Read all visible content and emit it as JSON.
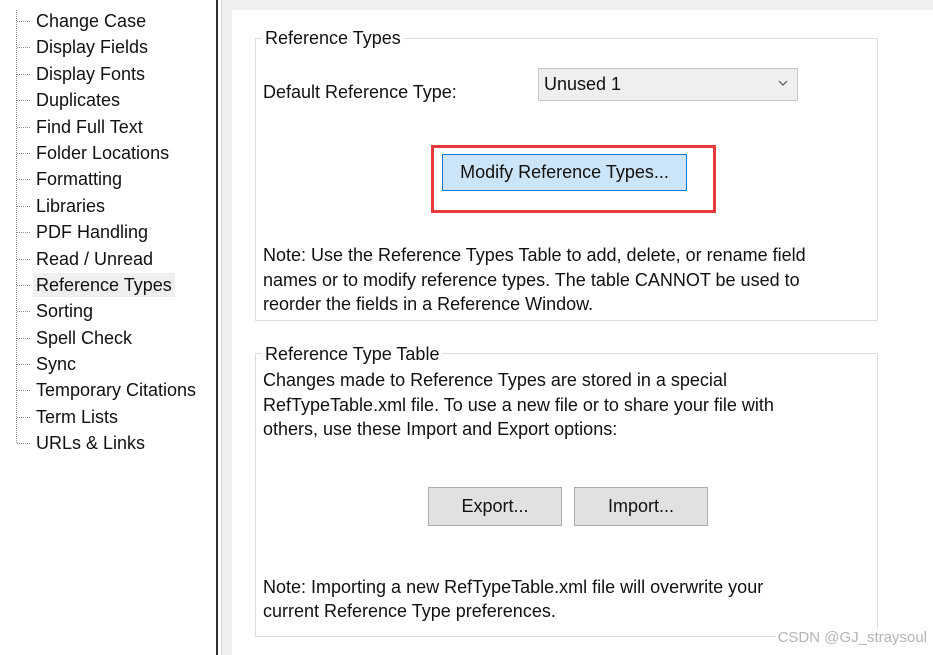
{
  "tree": {
    "items": [
      {
        "label": "Change Case"
      },
      {
        "label": "Display Fields"
      },
      {
        "label": "Display Fonts"
      },
      {
        "label": "Duplicates"
      },
      {
        "label": "Find Full Text"
      },
      {
        "label": "Folder Locations"
      },
      {
        "label": "Formatting"
      },
      {
        "label": "Libraries"
      },
      {
        "label": "PDF Handling"
      },
      {
        "label": "Read / Unread"
      },
      {
        "label": "Reference Types",
        "selected": true
      },
      {
        "label": "Sorting"
      },
      {
        "label": "Spell Check"
      },
      {
        "label": "Sync"
      },
      {
        "label": "Temporary Citations"
      },
      {
        "label": "Term Lists"
      },
      {
        "label": "URLs & Links"
      }
    ]
  },
  "reference_types": {
    "title": "Reference Types",
    "default_label": "Default Reference Type:",
    "default_value": "Unused 1",
    "modify_button": "Modify Reference Types...",
    "note_lines": [
      "Note: Use the Reference Types Table to add, delete, or rename field",
      "names or to modify reference types.  The table CANNOT be used to",
      "reorder the fields in a Reference Window."
    ]
  },
  "reference_type_table": {
    "title": "Reference Type Table",
    "desc_lines": [
      "Changes made to Reference Types are stored in a special",
      "RefTypeTable.xml file.  To use a new file or to share your file with",
      "others, use these Import and Export options:"
    ],
    "export_button": "Export...",
    "import_button": "Import...",
    "note_lines": [
      "Note: Importing a new RefTypeTable.xml file will overwrite your",
      "current Reference Type preferences."
    ]
  },
  "icons": {
    "dropdown_arrow": "chevron-down-icon"
  },
  "colors": {
    "highlight": "#e83a3a",
    "primary_button_bg": "#cce4f7",
    "primary_button_border": "#0078d7"
  },
  "watermark": "CSDN @GJ_straysoul"
}
